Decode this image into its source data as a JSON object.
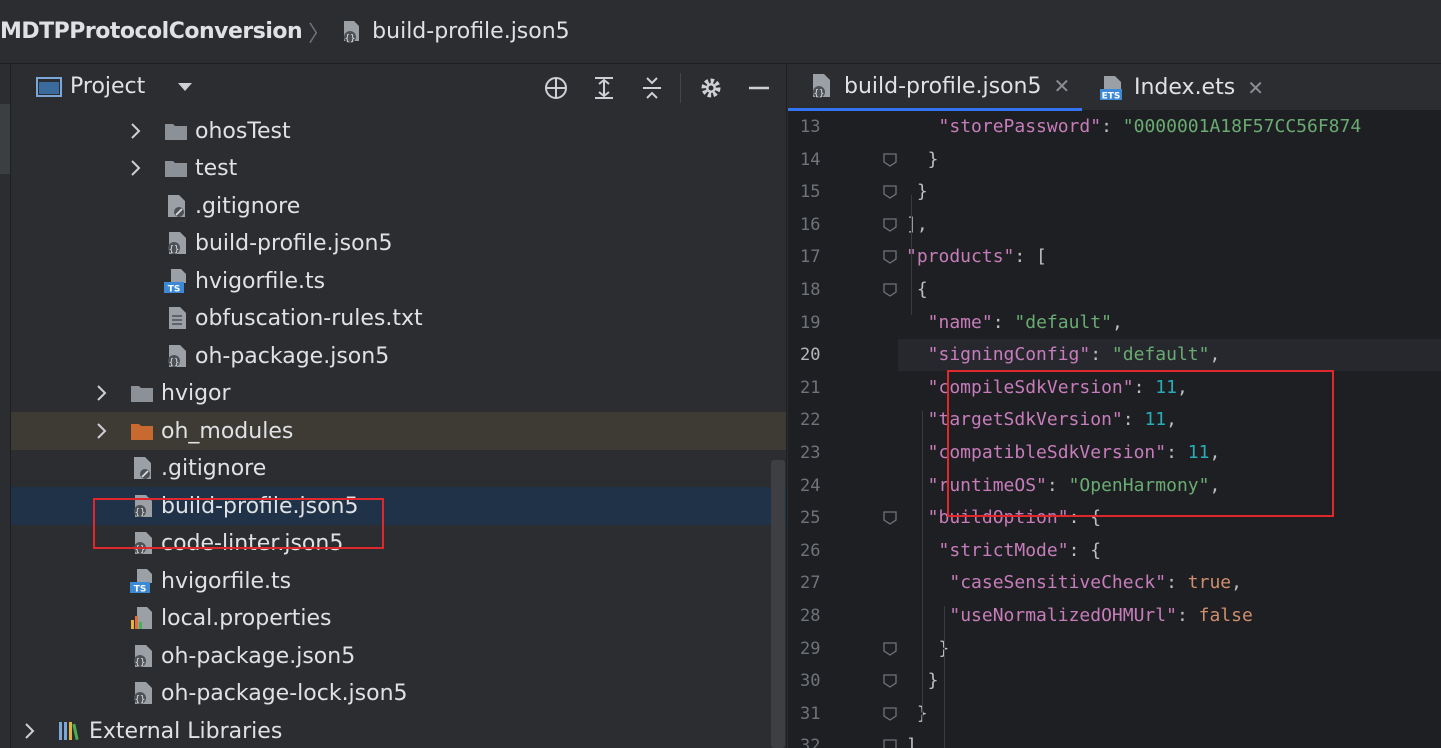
{
  "breadcrumb": {
    "project": "MDTPProtocolConversion",
    "separator": "〉",
    "file": "build-profile.json5"
  },
  "project_panel": {
    "title": "Project",
    "tree": [
      {
        "label": "ohosTest",
        "type": "folder",
        "expandable": true
      },
      {
        "label": "test",
        "type": "folder",
        "expandable": true
      },
      {
        "label": ".gitignore",
        "type": "ignore-file"
      },
      {
        "label": "build-profile.json5",
        "type": "json5-file"
      },
      {
        "label": "hvigorfile.ts",
        "type": "ts-file"
      },
      {
        "label": "obfuscation-rules.txt",
        "type": "text-file"
      },
      {
        "label": "oh-package.json5",
        "type": "json5-file"
      },
      {
        "label": "hvigor",
        "type": "folder",
        "expandable": true
      },
      {
        "label": "oh_modules",
        "type": "orange-folder",
        "expandable": true
      },
      {
        "label": ".gitignore",
        "type": "ignore-file"
      },
      {
        "label": "build-profile.json5",
        "type": "json5-file",
        "selected": true
      },
      {
        "label": "code-linter.json5",
        "type": "json5-file"
      },
      {
        "label": "hvigorfile.ts",
        "type": "ts-file"
      },
      {
        "label": "local.properties",
        "type": "properties-file"
      },
      {
        "label": "oh-package.json5",
        "type": "json5-file"
      },
      {
        "label": "oh-package-lock.json5",
        "type": "json5-file"
      },
      {
        "label": "External Libraries",
        "type": "libraries",
        "expandable": true
      }
    ]
  },
  "editor": {
    "tabs": [
      {
        "label": "build-profile.json5",
        "active": true,
        "icon": "json5-file-icon",
        "close": "✕"
      },
      {
        "label": "Index.ets",
        "active": false,
        "icon": "ets-file-icon",
        "close": "✕"
      }
    ],
    "current_line": 20,
    "lines": [
      {
        "no": "13",
        "t": [
          [
            "k",
            "\"storePassword\""
          ],
          [
            "p",
            ": "
          ],
          [
            "s",
            "\"0000001A18F57CC56F874"
          ]
        ]
      },
      {
        "no": "14",
        "t": [
          [
            "p",
            "}"
          ]
        ]
      },
      {
        "no": "15",
        "t": [
          [
            "p",
            "}"
          ]
        ]
      },
      {
        "no": "16",
        "t": [
          [
            "p",
            "],"
          ]
        ]
      },
      {
        "no": "17",
        "t": [
          [
            "k",
            "\"products\""
          ],
          [
            "p",
            ": ["
          ]
        ]
      },
      {
        "no": "18",
        "t": [
          [
            "p",
            "{"
          ]
        ]
      },
      {
        "no": "19",
        "t": [
          [
            "k",
            "\"name\""
          ],
          [
            "p",
            ": "
          ],
          [
            "s",
            "\"default\""
          ],
          [
            "p",
            ","
          ]
        ]
      },
      {
        "no": "20",
        "t": [
          [
            "k",
            "\"signingConfig\""
          ],
          [
            "p",
            ": "
          ],
          [
            "s",
            "\"default\""
          ],
          [
            "p",
            ","
          ]
        ]
      },
      {
        "no": "21",
        "t": [
          [
            "k",
            "\"compileSdkVersion\""
          ],
          [
            "p",
            ": "
          ],
          [
            "n",
            "11"
          ],
          [
            "p",
            ","
          ]
        ]
      },
      {
        "no": "22",
        "t": [
          [
            "k",
            "\"targetSdkVersion\""
          ],
          [
            "p",
            ": "
          ],
          [
            "n",
            "11"
          ],
          [
            "p",
            ","
          ]
        ]
      },
      {
        "no": "23",
        "t": [
          [
            "k",
            "\"compatibleSdkVersion\""
          ],
          [
            "p",
            ": "
          ],
          [
            "n",
            "11"
          ],
          [
            "p",
            ","
          ]
        ]
      },
      {
        "no": "24",
        "t": [
          [
            "k",
            "\"runtimeOS\""
          ],
          [
            "p",
            ": "
          ],
          [
            "s",
            "\"OpenHarmony\""
          ],
          [
            "p",
            ","
          ]
        ]
      },
      {
        "no": "25",
        "t": [
          [
            "k",
            "\"buildOption\""
          ],
          [
            "p",
            ": {"
          ]
        ]
      },
      {
        "no": "26",
        "t": [
          [
            "k",
            "\"strictMode\""
          ],
          [
            "p",
            ": {"
          ]
        ]
      },
      {
        "no": "27",
        "t": [
          [
            "k",
            "\"caseSensitiveCheck\""
          ],
          [
            "p",
            ": "
          ],
          [
            "kw",
            "true"
          ],
          [
            "p",
            ","
          ]
        ]
      },
      {
        "no": "28",
        "t": [
          [
            "k",
            "\"useNormalizedOHMUrl\""
          ],
          [
            "p",
            ": "
          ],
          [
            "kw",
            "false"
          ]
        ]
      },
      {
        "no": "29",
        "t": [
          [
            "p",
            "}"
          ]
        ]
      },
      {
        "no": "30",
        "t": [
          [
            "p",
            "}"
          ]
        ]
      },
      {
        "no": "31",
        "t": [
          [
            "p",
            "}"
          ]
        ]
      },
      {
        "no": "32",
        "t": [
          [
            "p",
            "]"
          ]
        ]
      }
    ]
  },
  "colors": {
    "annotation_red": "#e0282c",
    "selection": "#1f3248",
    "accent": "#3574f0"
  }
}
